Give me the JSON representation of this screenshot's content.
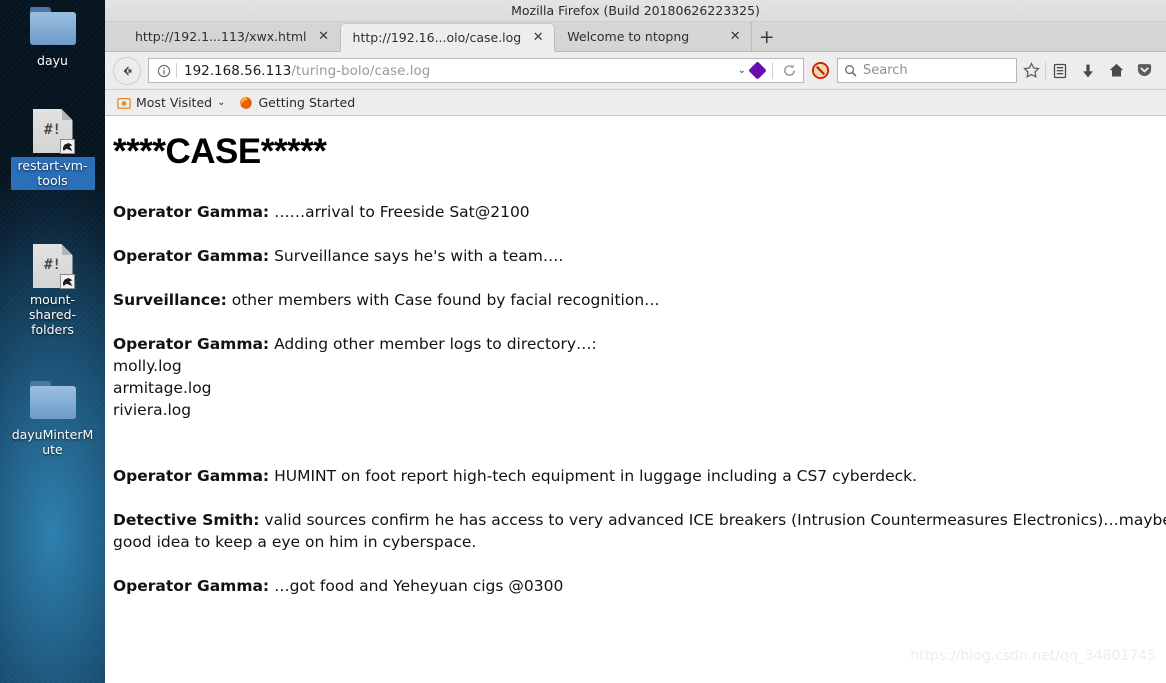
{
  "desktop": {
    "icons": [
      {
        "label": "dayu",
        "type": "folder",
        "selected": false
      },
      {
        "label": "restart-vm-tools",
        "type": "script",
        "selected": true
      },
      {
        "label": "mount-shared-folders",
        "type": "script",
        "selected": false
      },
      {
        "label": "dayuMinterMute",
        "type": "folder",
        "selected": false
      }
    ]
  },
  "window": {
    "title": "Mozilla Firefox (Build 20180626223325)"
  },
  "tabs": [
    {
      "label": "http://192.1...113/xwx.html",
      "close": "✕",
      "active": false
    },
    {
      "label": "http://192.16...olo/case.log",
      "close": "✕",
      "active": true
    },
    {
      "label": "Welcome to ntopng",
      "close": "✕",
      "active": false
    }
  ],
  "newtab_label": "+",
  "navbar": {
    "back_label": "←",
    "url_host": "192.168.56.113",
    "url_path": "/turing-bolo/case.log",
    "chevron": "⌄",
    "reload_label": "↻",
    "search_placeholder": "Search",
    "icons": {
      "identity": "info-icon",
      "container": "container-diamond-icon",
      "noscript": "noscript-blocked-icon",
      "bookmark_star": "star-icon",
      "library": "library-icon",
      "downloads": "download-arrow-icon",
      "home": "home-icon",
      "pocket": "pocket-icon"
    }
  },
  "bookmarks": [
    {
      "label": "Most Visited",
      "icon": "most-visited-icon",
      "chevron": "⌄"
    },
    {
      "label": "Getting Started",
      "icon": "firefox-icon",
      "chevron": ""
    }
  ],
  "page": {
    "heading": "****CASE*****",
    "lines": [
      {
        "speaker": "Operator Gamma:",
        "text": " ……arrival to Freeside Sat@2100"
      },
      {
        "speaker": "Operator Gamma:",
        "text": " Surveillance says he's with a team…."
      },
      {
        "speaker": "Surveillance:",
        "text": " other members with Case found by facial recognition…"
      },
      {
        "speaker": "Operator Gamma:",
        "text": " Adding other member logs to directory…:"
      }
    ],
    "log_files": [
      "molly.log",
      "armitage.log",
      "riviera.log"
    ],
    "lines2": [
      {
        "speaker": "Operator Gamma:",
        "text": " HUMINT on foot report high-tech equipment in luggage including a CS7 cyberdeck."
      },
      {
        "speaker": "Detective Smith:",
        "text": " valid sources confirm he has access to very advanced ICE breakers (Intrusion Countermeasures Electronics)…maybe a good idea to keep a eye on him in cyberspace."
      },
      {
        "speaker": "Operator Gamma:",
        "text": " …got food and Yeheyuan cigs @0300"
      }
    ],
    "watermark": "https://blog.csdn.net/qq_34801745"
  }
}
